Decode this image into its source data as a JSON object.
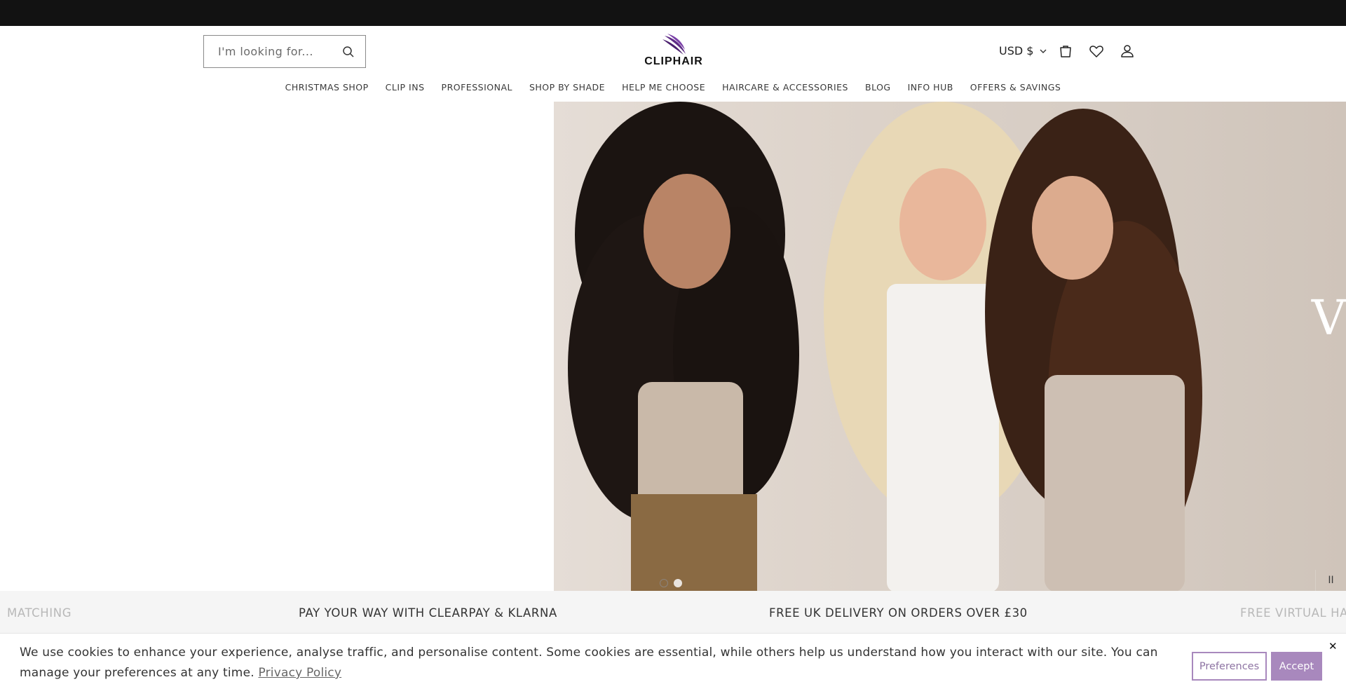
{
  "announcement": {
    "text": ""
  },
  "header": {
    "search": {
      "placeholder": "I'm looking for..."
    },
    "logo": {
      "text": "CLIPHAIR"
    },
    "currency": {
      "label": "USD $"
    },
    "icons": [
      "search-icon",
      "cart-icon",
      "heart-icon",
      "account-icon",
      "chevron-down-icon"
    ]
  },
  "nav": {
    "items": [
      {
        "label": "CHRISTMAS SHOP"
      },
      {
        "label": "CLIP INS"
      },
      {
        "label": "PROFESSIONAL"
      },
      {
        "label": "SHOP BY SHADE"
      },
      {
        "label": "HELP ME CHOOSE"
      },
      {
        "label": "HAIRCARE & ACCESSORIES"
      },
      {
        "label": "BLOG"
      },
      {
        "label": "INFO HUB"
      },
      {
        "label": "OFFERS & SAVINGS"
      }
    ]
  },
  "hero": {
    "cut_text": "V",
    "slides_total": 2,
    "active_slide": 2,
    "pause_label": "II"
  },
  "marquee": {
    "items": [
      {
        "text": "MATCHING"
      },
      {
        "text": "PAY YOUR WAY WITH CLEARPAY & KLARNA"
      },
      {
        "text": "FREE UK DELIVERY ON ORDERS OVER £30"
      },
      {
        "text": "FREE VIRTUAL HA"
      }
    ]
  },
  "cookie": {
    "message": "We use cookies to enhance your experience, analyse traffic, and personalise content. Some cookies are essential, while others help us understand how you interact with our site. You can manage your preferences at any time.",
    "policy_link": "Privacy Policy",
    "preferences_label": "Preferences",
    "accept_label": "Accept",
    "close_label": "✕"
  },
  "colors": {
    "announcement_bg": "#121212",
    "accent_purple": "#a888bd",
    "marquee_bg": "#f5f5f5"
  }
}
